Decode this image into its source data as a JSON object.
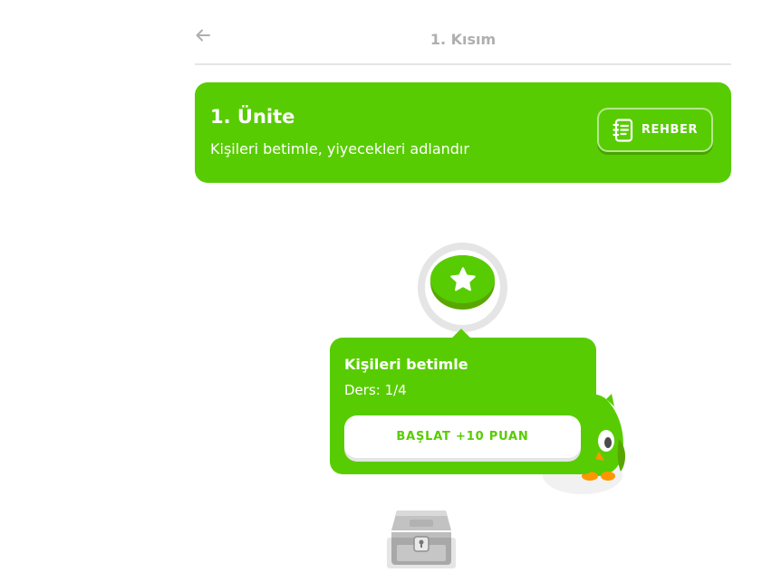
{
  "header": {
    "back_icon": "arrow-left-icon",
    "section_title": "1. Kısım"
  },
  "unit": {
    "title": "1. Ünite",
    "subtitle": "Kişileri betimle, yiyecekleri adlandır",
    "guide_label": "REHBER",
    "guide_icon": "notebook-icon"
  },
  "path": {
    "active_node_icon": "star-icon",
    "chest_icon": "treasure-chest-icon",
    "mascot": "owl-mascot"
  },
  "lesson_popup": {
    "title": "Kişileri betimle",
    "progress": "Ders: 1/4",
    "start_label": "BAŞLAT +10 PUAN"
  },
  "colors": {
    "brand_green": "#58cc02",
    "brand_green_dark": "#58a700",
    "muted_gray": "#afafaf",
    "divider": "#e5e5e5"
  }
}
